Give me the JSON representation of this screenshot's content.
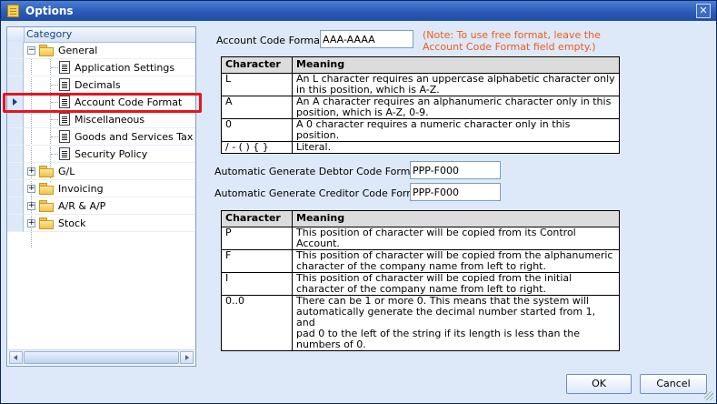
{
  "window": {
    "title": "Options",
    "close_label": "✕"
  },
  "sidebar": {
    "header": "Category",
    "items": [
      {
        "label": "General",
        "type": "folder",
        "expanded": true
      },
      {
        "label": "Application Settings",
        "type": "page"
      },
      {
        "label": "Decimals",
        "type": "page"
      },
      {
        "label": "Account Code Format",
        "type": "page",
        "selected": true
      },
      {
        "label": "Miscellaneous",
        "type": "page"
      },
      {
        "label": "Goods and Services Tax",
        "type": "page"
      },
      {
        "label": "Security Policy",
        "type": "page"
      },
      {
        "label": "G/L",
        "type": "folder",
        "expanded": false
      },
      {
        "label": "Invoicing",
        "type": "folder",
        "expanded": false
      },
      {
        "label": "A/R & A/P",
        "type": "folder",
        "expanded": false
      },
      {
        "label": "Stock",
        "type": "folder",
        "expanded": false
      }
    ]
  },
  "account_code": {
    "label": "Account Code Format:",
    "value": "AAA-AAAA",
    "note_line1": "(Note: To use free format, leave the",
    "note_line2": "Account Code Format field empty.)"
  },
  "table1": {
    "headers": [
      "Character",
      "Meaning"
    ],
    "rows": [
      {
        "char": "L",
        "line1": "An L character requires an uppercase alphabetic character only",
        "line2": "in this position, which is A-Z."
      },
      {
        "char": "A",
        "line1": "An A character requires an alphanumeric character only in this",
        "line2": "position, which is A-Z, 0-9."
      },
      {
        "char": "0",
        "line1": "A 0 character requires a numeric character only in this position.",
        "line2": ""
      },
      {
        "char": "/ - ( ) { }",
        "line1": "Literal.",
        "line2": ""
      }
    ]
  },
  "debtor": {
    "label": "Automatic Generate Debtor Code Format:",
    "value": "PPP-F000"
  },
  "creditor": {
    "label": "Automatic Generate Creditor Code Format",
    "value": "PPP-F000"
  },
  "table2": {
    "headers": [
      "Character",
      "Meaning"
    ],
    "rows": [
      {
        "char": "P",
        "lines": [
          "This position of character will be copied from its Control",
          "Account."
        ]
      },
      {
        "char": "F",
        "lines": [
          "This position of character will be copied from the alphanumeric",
          "character of the company name from left to right."
        ]
      },
      {
        "char": "I",
        "lines": [
          "This position of character will be copied from the initial",
          "character of the company name from left to right."
        ]
      },
      {
        "char": "0..0",
        "lines": [
          "There can be 1 or more 0. This means that the system will",
          "automatically generate the decimal number started from 1, and",
          "pad 0 to the left of the string if its length is less than the",
          "numbers of 0."
        ]
      }
    ]
  },
  "buttons": {
    "ok": "OK",
    "cancel": "Cancel"
  },
  "colors": {
    "title_bar": "#2b5bb8",
    "note": "#f05a1a",
    "highlight": "#e8141c",
    "background": "#dde9f8"
  }
}
